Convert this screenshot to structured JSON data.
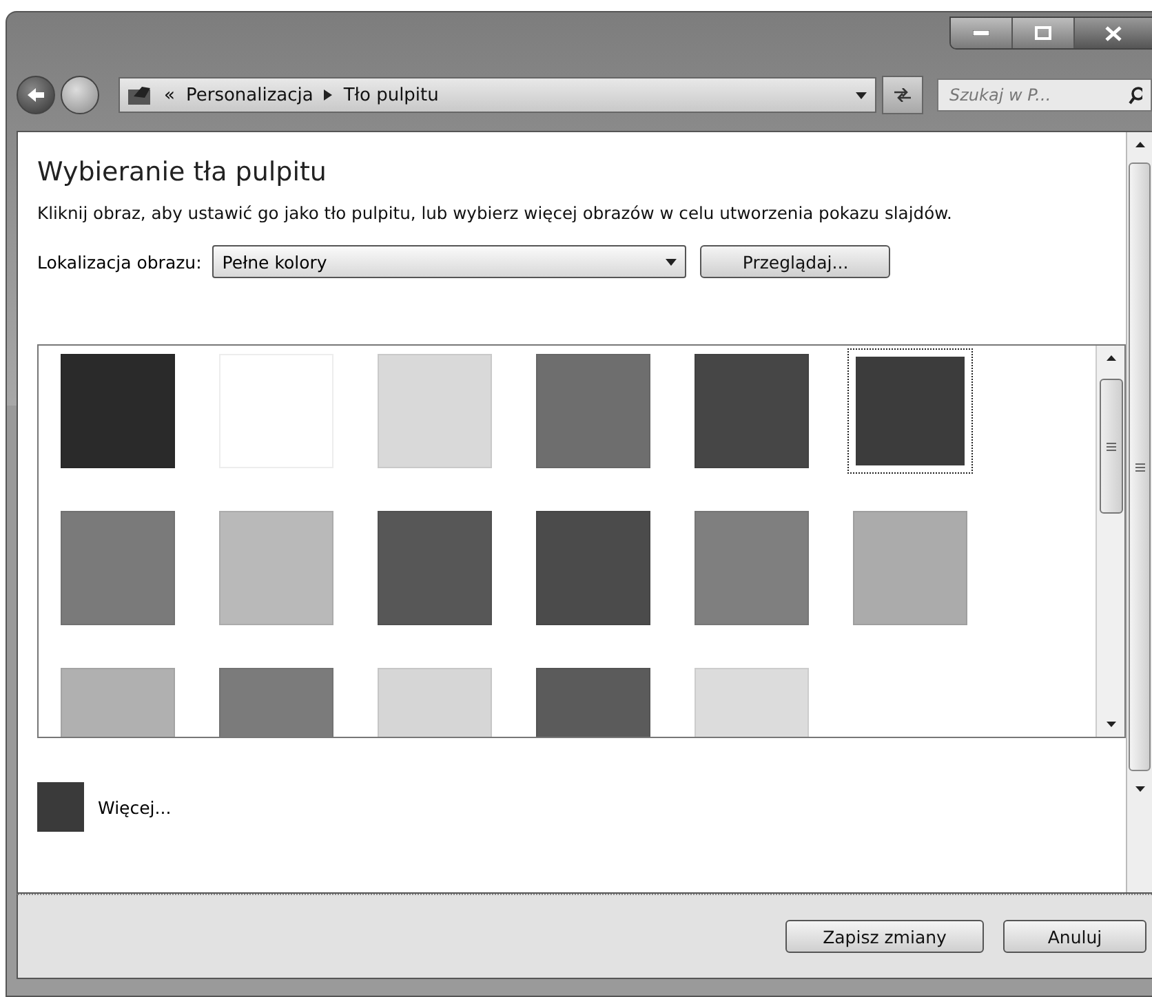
{
  "address_bar": {
    "overflow_mark": "«",
    "breadcrumbs": [
      "Personalizacja",
      "Tło pulpitu"
    ]
  },
  "search": {
    "placeholder": "Szukaj w P..."
  },
  "heading": "Wybieranie tła pulpitu",
  "description": "Kliknij obraz, aby ustawić go jako tło pulpitu, lub wybierz więcej obrazów w celu utworzenia pokazu slajdów.",
  "location": {
    "label": "Lokalizacja obrazu:",
    "value": "Pełne kolory",
    "browse_button": "Przeglądaj..."
  },
  "swatches": [
    {
      "color": "#2a2a2a",
      "selected": false
    },
    {
      "color": "#ffffff",
      "selected": false
    },
    {
      "color": "#d9d9d9",
      "selected": false
    },
    {
      "color": "#6e6e6e",
      "selected": false
    },
    {
      "color": "#464646",
      "selected": false
    },
    {
      "color": "#3c3c3c",
      "selected": true
    },
    {
      "color": "#7a7a7a",
      "selected": false
    },
    {
      "color": "#b9b9b9",
      "selected": false
    },
    {
      "color": "#575757",
      "selected": false
    },
    {
      "color": "#4b4b4b",
      "selected": false
    },
    {
      "color": "#7f7f7f",
      "selected": false
    },
    {
      "color": "#ababab",
      "selected": false
    },
    {
      "color": "#b0b0b0",
      "selected": false
    },
    {
      "color": "#7b7b7b",
      "selected": false
    },
    {
      "color": "#d6d6d6",
      "selected": false
    },
    {
      "color": "#5b5b5b",
      "selected": false
    },
    {
      "color": "#dcdcdc",
      "selected": false
    }
  ],
  "more": {
    "label": "Więcej...",
    "color": "#3a3a3a"
  },
  "buttons": [
    "Zapisz zmiany",
    "Anuluj"
  ]
}
